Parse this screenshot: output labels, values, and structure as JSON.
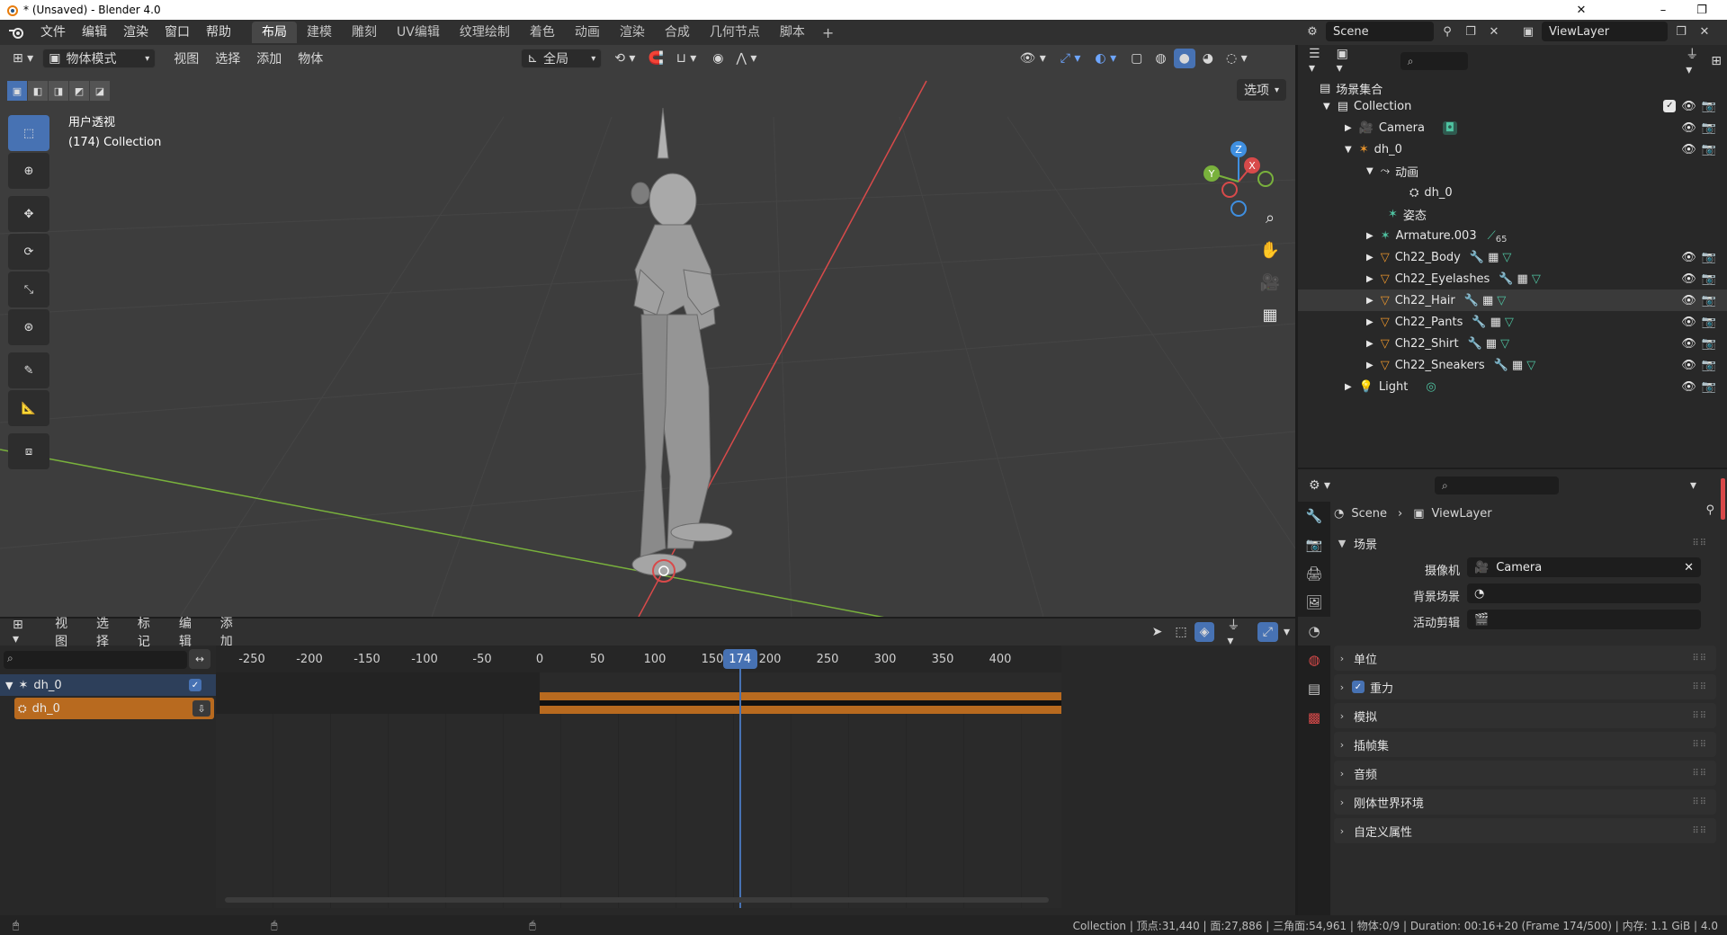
{
  "window": {
    "title": "* (Unsaved) - Blender 4.0",
    "controls": [
      "–",
      "❐",
      "✕"
    ]
  },
  "menubar": {
    "items": [
      "文件",
      "编辑",
      "渲染",
      "窗口",
      "帮助"
    ],
    "workspaces": [
      "布局",
      "建模",
      "雕刻",
      "UV编辑",
      "纹理绘制",
      "着色",
      "动画",
      "渲染",
      "合成",
      "几何节点",
      "脚本"
    ],
    "active_workspace": "布局",
    "scene_name": "Scene",
    "view_layer": "ViewLayer"
  },
  "viewport": {
    "mode": "物体模式",
    "menus": [
      "视图",
      "选择",
      "添加",
      "物体"
    ],
    "transform_orientation": "全局",
    "options_label": "选项",
    "info_view": "用户透视",
    "info_collection": "(174) Collection",
    "gizmo_axes": [
      "Z",
      "X",
      "Y"
    ],
    "background_color": "#3d3d3d"
  },
  "timeline": {
    "menus": [
      "视图",
      "选择",
      "标记",
      "编辑",
      "添加"
    ],
    "ticks": [
      "-250",
      "-200",
      "-150",
      "-100",
      "-50",
      "0",
      "50",
      "100",
      "150",
      "200",
      "250",
      "300",
      "350",
      "400"
    ],
    "current_frame": "174",
    "channels": [
      {
        "name": "dh_0",
        "type": "object"
      },
      {
        "name": "dh_0",
        "type": "action"
      }
    ],
    "action_color": "#b86a1f"
  },
  "outliner": {
    "root": "场景集合",
    "rows": [
      {
        "label": "Collection"
      },
      {
        "label": "Camera"
      },
      {
        "label": "dh_0"
      },
      {
        "label": "动画"
      },
      {
        "label": "dh_0"
      },
      {
        "label": "姿态"
      },
      {
        "label": "Armature.003",
        "badge": "65"
      },
      {
        "label": "Ch22_Body"
      },
      {
        "label": "Ch22_Eyelashes"
      },
      {
        "label": "Ch22_Hair"
      },
      {
        "label": "Ch22_Pants"
      },
      {
        "label": "Ch22_Shirt"
      },
      {
        "label": "Ch22_Sneakers"
      },
      {
        "label": "Light"
      }
    ]
  },
  "properties": {
    "breadcrumb": [
      "Scene",
      "ViewLayer"
    ],
    "section": "场景",
    "fields": [
      {
        "label": "摄像机",
        "value": "Camera"
      },
      {
        "label": "背景场景",
        "value": ""
      },
      {
        "label": "活动剪辑",
        "value": ""
      }
    ],
    "panels": [
      "单位",
      "重力",
      "模拟",
      "插帧集",
      "音频",
      "刚体世界环境",
      "自定义属性"
    ]
  },
  "statusbar": {
    "text": "Collection | 顶点:31,440 | 面:27,886 | 三角面:54,961 | 物体:0/9 | Duration: 00:16+20 (Frame 174/500) | 内存: 1.1 GiB | 4.0"
  },
  "colors": {
    "accent": "#4772b3",
    "orange": "#e8942c",
    "x_axis": "#d84a4a",
    "y_axis": "#79b13c",
    "z_axis": "#3f8fe0"
  }
}
